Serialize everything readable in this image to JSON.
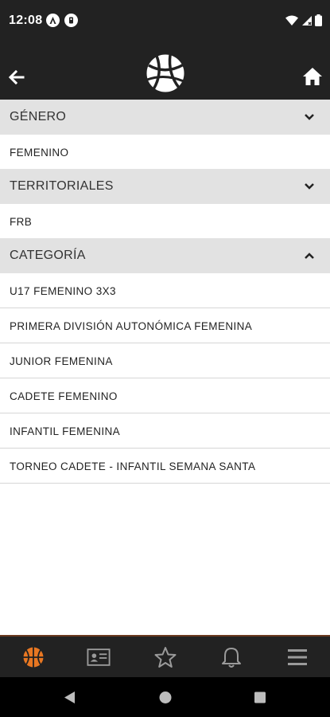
{
  "status_bar": {
    "time": "12:08"
  },
  "sections": [
    {
      "title": "GÉNERO",
      "expanded": false,
      "items": [
        "FEMENINO"
      ]
    },
    {
      "title": "TERRITORIALES",
      "expanded": false,
      "items": [
        "FRB"
      ]
    },
    {
      "title": "CATEGORÍA",
      "expanded": true,
      "items": [
        "U17 FEMENINO 3X3",
        "PRIMERA DIVISIÓN AUTONÓMICA FEMENINA",
        "JUNIOR FEMENINA",
        "CADETE FEMENINO",
        "INFANTIL FEMENINA",
        "TORNEO CADETE - INFANTIL SEMANA SANTA"
      ]
    }
  ],
  "bottom_nav": {
    "items": [
      {
        "icon": "basketball-icon",
        "active": true
      },
      {
        "icon": "id-card-icon",
        "active": false
      },
      {
        "icon": "star-icon",
        "active": false
      },
      {
        "icon": "bell-icon",
        "active": false
      },
      {
        "icon": "menu-icon",
        "active": false
      }
    ]
  },
  "colors": {
    "bar_bg": "#222222",
    "accent": "#e87722",
    "section_bg": "#e2e2e2"
  }
}
